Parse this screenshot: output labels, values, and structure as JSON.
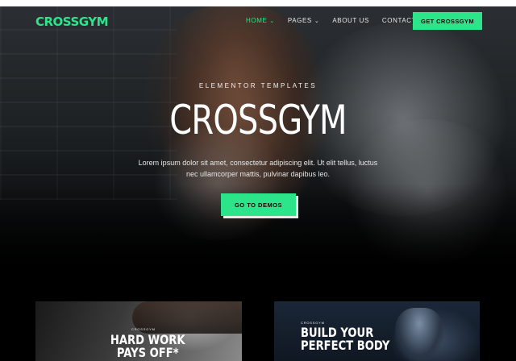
{
  "header": {
    "logo": "CROSSGYM",
    "nav": [
      {
        "label": "HOME",
        "dropdown": true,
        "active": true
      },
      {
        "label": "PAGES",
        "dropdown": true,
        "active": false
      },
      {
        "label": "ABOUT US",
        "dropdown": false,
        "active": false
      },
      {
        "label": "CONTACT US",
        "dropdown": false,
        "active": false
      }
    ],
    "cta_label": "GET CROSSGYM"
  },
  "hero": {
    "eyebrow": "ELEMENTOR TEMPLATES",
    "title": "CROSSGYM",
    "lead": "Lorem ipsum dolor sit amet, consectetur adipiscing elit. Ut elit tellus, luctus nec ullamcorper mattis, pulvinar dapibus leo.",
    "button_label": "GO TO DEMOS"
  },
  "cards": [
    {
      "kicker": "CROSSGYM",
      "title": "HARD WORK PAYS OFF*"
    },
    {
      "kicker": "CROSSGYM",
      "title": "BUILD YOUR PERFECT BODY"
    }
  ],
  "colors": {
    "accent": "#2ce58a",
    "background": "#000000"
  }
}
